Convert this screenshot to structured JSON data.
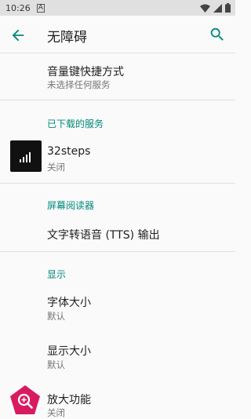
{
  "status_bar": {
    "time": "10:26",
    "notification_icon": "A"
  },
  "app_bar": {
    "title": "无障碍",
    "back_icon": "arrow-back-icon",
    "search_icon": "search-icon"
  },
  "items": {
    "shortcut": {
      "title": "音量键快捷方式",
      "subtitle": "未选择任何服务"
    },
    "downloaded_header": "已下载的服务",
    "steps": {
      "title": "32steps",
      "subtitle": "关闭"
    },
    "screen_reader_header": "屏幕阅读器",
    "tts": {
      "title": "文字转语音 (TTS) 输出"
    },
    "display_header": "显示",
    "font_size": {
      "title": "字体大小",
      "subtitle": "默认"
    },
    "display_size": {
      "title": "显示大小",
      "subtitle": "默认"
    },
    "magnify": {
      "title": "放大功能",
      "subtitle": "关闭"
    }
  },
  "colors": {
    "accent": "#00897b",
    "magnify_icon_bg": "#d81b60"
  }
}
